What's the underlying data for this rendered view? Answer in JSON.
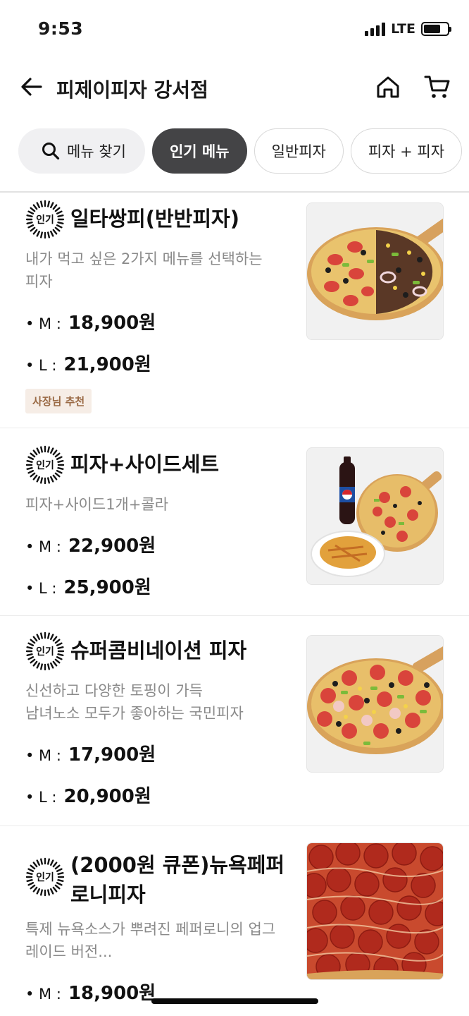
{
  "status_bar": {
    "time": "9:53",
    "network": "LTE"
  },
  "header": {
    "store_name": "피제이피자 강서점"
  },
  "tabs": [
    {
      "label": "메뉴 찾기"
    },
    {
      "label": "인기 메뉴"
    },
    {
      "label": "일반피자"
    },
    {
      "label": "피자 + 피자"
    }
  ],
  "badge_label": "인기",
  "menu": [
    {
      "title": "일타쌍피(반반피자)",
      "desc_lines": [
        "내가 먹고 싶은  2가지 메뉴를 선택하는",
        "피자"
      ],
      "prices": [
        {
          "size": "• M :",
          "price": "18,900원"
        },
        {
          "size": "• L :",
          "price": "21,900원"
        }
      ],
      "tag": "사장님 추천"
    },
    {
      "title": "피자+사이드세트",
      "desc_lines": [
        "피자+사이드1개+콜라"
      ],
      "prices": [
        {
          "size": "• M :",
          "price": "22,900원"
        },
        {
          "size": "• L :",
          "price": "25,900원"
        }
      ]
    },
    {
      "title": "슈퍼콤비네이션 피자",
      "desc_lines": [
        "신선하고 다양한 토핑이 가득",
        "남녀노소 모두가 좋아하는 국민피자"
      ],
      "prices": [
        {
          "size": "• M :",
          "price": "17,900원"
        },
        {
          "size": "• L :",
          "price": "20,900원"
        }
      ]
    },
    {
      "title_lines": [
        "(2000원 큐폰)뉴욕페퍼",
        "로니피자"
      ],
      "desc_lines": [
        "특제 뉴욕소스가 뿌려진 페퍼로니의 업그",
        "레이드 버전..."
      ],
      "prices": [
        {
          "size": "• M :",
          "price": "18,900원"
        }
      ]
    }
  ],
  "colors": {
    "active_tab": "#444446",
    "search_tab": "#f0f0f2",
    "owner_tag_bg": "#f6ede6",
    "owner_tag_text": "#9a6a45",
    "desc_text": "#8a8a8a"
  },
  "icons": [
    "back-arrow-icon",
    "home-icon",
    "cart-icon",
    "search-icon",
    "popular-badge-icon"
  ]
}
